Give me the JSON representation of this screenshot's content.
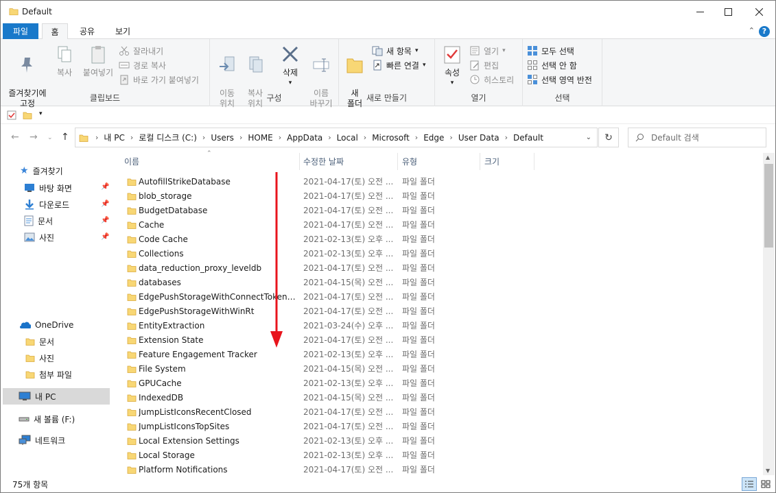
{
  "window": {
    "title": "Default"
  },
  "ribbon_tabs": {
    "file": "파일",
    "home": "홈",
    "share": "공유",
    "view": "보기"
  },
  "ribbon": {
    "clipboard": {
      "label": "클립보드",
      "pin": "즐겨찾기에\n고정",
      "copy": "복사",
      "paste": "붙여넣기",
      "cut": "잘라내기",
      "copy_path": "경로 복사",
      "paste_shortcut": "바로 가기 붙여넣기"
    },
    "organize": {
      "label": "구성",
      "move_to": "이동\n위치",
      "copy_to": "복사\n위치",
      "delete": "삭제",
      "rename": "이름\n바꾸기"
    },
    "new": {
      "label": "새로 만들기",
      "new_folder": "새\n폴더",
      "new_item": "새 항목",
      "easy_access": "빠른 연결"
    },
    "open": {
      "label": "열기",
      "properties": "속성",
      "open": "열기",
      "edit": "편집",
      "history": "히스토리"
    },
    "select": {
      "label": "선택",
      "select_all": "모두 선택",
      "select_none": "선택 안 함",
      "invert": "선택 영역 반전"
    }
  },
  "address": {
    "crumbs": [
      "내 PC",
      "로컬 디스크 (C:)",
      "Users",
      "HOME",
      "AppData",
      "Local",
      "Microsoft",
      "Edge",
      "User Data",
      "Default"
    ],
    "search_placeholder": "Default 검색"
  },
  "nav": {
    "quick_access": "즐겨찾기",
    "desktop": "바탕 화면",
    "downloads": "다운로드",
    "documents": "문서",
    "pictures": "사진",
    "onedrive": "OneDrive",
    "od_documents": "문서",
    "od_pictures": "사진",
    "od_attachments": "첨부 파일",
    "this_pc": "내 PC",
    "new_volume": "새 볼륨 (F:)",
    "network": "네트워크"
  },
  "columns": {
    "name": "이름",
    "modified": "수정한 날짜",
    "type": "유형",
    "size": "크기"
  },
  "files": [
    {
      "name": "AutofillStrikeDatabase",
      "date": "2021-04-17(토) 오전 ...",
      "type": "파일 폴더"
    },
    {
      "name": "blob_storage",
      "date": "2021-04-17(토) 오전 ...",
      "type": "파일 폴더"
    },
    {
      "name": "BudgetDatabase",
      "date": "2021-04-17(토) 오전 ...",
      "type": "파일 폴더"
    },
    {
      "name": "Cache",
      "date": "2021-04-17(토) 오전 ...",
      "type": "파일 폴더"
    },
    {
      "name": "Code Cache",
      "date": "2021-02-13(토) 오후 ...",
      "type": "파일 폴더"
    },
    {
      "name": "Collections",
      "date": "2021-02-13(토) 오후 ...",
      "type": "파일 폴더"
    },
    {
      "name": "data_reduction_proxy_leveldb",
      "date": "2021-04-17(토) 오전 ...",
      "type": "파일 폴더"
    },
    {
      "name": "databases",
      "date": "2021-04-15(목) 오전 ...",
      "type": "파일 폴더"
    },
    {
      "name": "EdgePushStorageWithConnectTokenAnd...",
      "date": "2021-04-17(토) 오전 ...",
      "type": "파일 폴더"
    },
    {
      "name": "EdgePushStorageWithWinRt",
      "date": "2021-04-17(토) 오전 ...",
      "type": "파일 폴더"
    },
    {
      "name": "EntityExtraction",
      "date": "2021-03-24(수) 오후 ...",
      "type": "파일 폴더"
    },
    {
      "name": "Extension State",
      "date": "2021-04-17(토) 오전 ...",
      "type": "파일 폴더"
    },
    {
      "name": "Feature Engagement Tracker",
      "date": "2021-02-13(토) 오후 ...",
      "type": "파일 폴더"
    },
    {
      "name": "File System",
      "date": "2021-04-15(목) 오전 ...",
      "type": "파일 폴더"
    },
    {
      "name": "GPUCache",
      "date": "2021-02-13(토) 오후 ...",
      "type": "파일 폴더"
    },
    {
      "name": "IndexedDB",
      "date": "2021-04-15(목) 오전 ...",
      "type": "파일 폴더"
    },
    {
      "name": "JumpListIconsRecentClosed",
      "date": "2021-04-17(토) 오전 ...",
      "type": "파일 폴더"
    },
    {
      "name": "JumpListIconsTopSites",
      "date": "2021-04-17(토) 오전 ...",
      "type": "파일 폴더"
    },
    {
      "name": "Local Extension Settings",
      "date": "2021-02-13(토) 오후 ...",
      "type": "파일 폴더"
    },
    {
      "name": "Local Storage",
      "date": "2021-02-13(토) 오후 ...",
      "type": "파일 폴더"
    },
    {
      "name": "Platform Notifications",
      "date": "2021-04-17(토) 오전 ...",
      "type": "파일 폴더"
    }
  ],
  "status": {
    "item_count": "75개 항목"
  },
  "colors": {
    "accent": "#1979ca",
    "folder": "#f8d775",
    "arrow": "#e8141c",
    "selection": "#d9d9d9"
  }
}
